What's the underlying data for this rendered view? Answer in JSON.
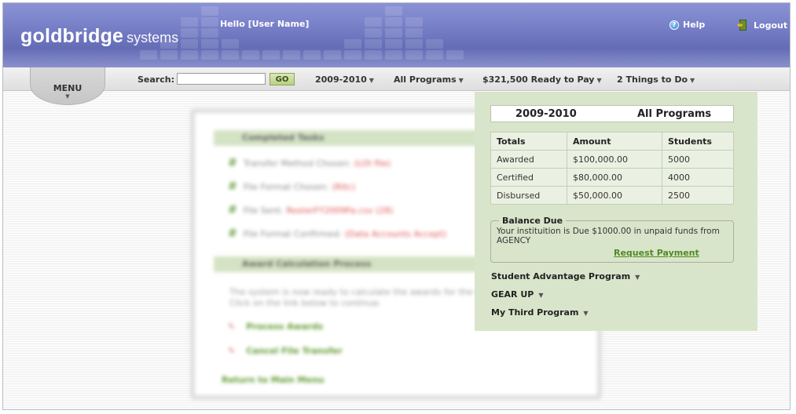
{
  "header": {
    "brand": "goldbridge",
    "brand_sub": "systems",
    "greeting": "Hello [User Name]",
    "help_label": "Help",
    "logout_label": "Logout"
  },
  "toolbar": {
    "menu_label": "MENU",
    "search_label": "Search:",
    "search_value": "",
    "go_label": "GO",
    "year_dropdown": "2009-2010",
    "programs_dropdown": "All Programs",
    "ready_to_pay_dropdown": "$321,500 Ready to Pay",
    "todo_dropdown": "2 Things to Do"
  },
  "panel": {
    "year": "2009-2010",
    "programs": "All Programs",
    "table": {
      "headers": [
        "Totals",
        "Amount",
        "Students"
      ],
      "rows": [
        [
          "Awarded",
          "$100,000.00",
          "5000"
        ],
        [
          "Certified",
          "$80,000.00",
          "4000"
        ],
        [
          "Disbursed",
          "$50,000.00",
          "2500"
        ]
      ]
    },
    "balance": {
      "title": "Balance Due",
      "message": "Your instituition is Due $1000.00 in unpaid funds from AGENCY",
      "action": "Request Payment"
    },
    "program_list": [
      "Student Advantage Program",
      "GEAR UP",
      "My Third Program"
    ]
  },
  "background": {
    "section1_title": "Completed Tasks",
    "tasks": [
      {
        "text": "Transfer Method Chosen:",
        "detail": "(LOI file)"
      },
      {
        "text": "File Format Chosen:",
        "detail": "(Rltc)"
      },
      {
        "text": "File Sent:",
        "detail": "RosterFY2009Fa.csv (28)"
      },
      {
        "text": "File Format Confirmed:",
        "detail": "(Data Accounts Accept)"
      }
    ],
    "section2_title": "Award Calculation Process",
    "paragraph": "The system is now ready to calculate the awards for the file you uploaded. Click on the link below to continue.",
    "links": [
      "Process Awards",
      "Cancel File Transfer"
    ],
    "footer_link": "Return to Main Menu"
  },
  "colors": {
    "header": "#7880c8",
    "panel": "#d9e5cb",
    "link_green": "#4f8a22"
  }
}
